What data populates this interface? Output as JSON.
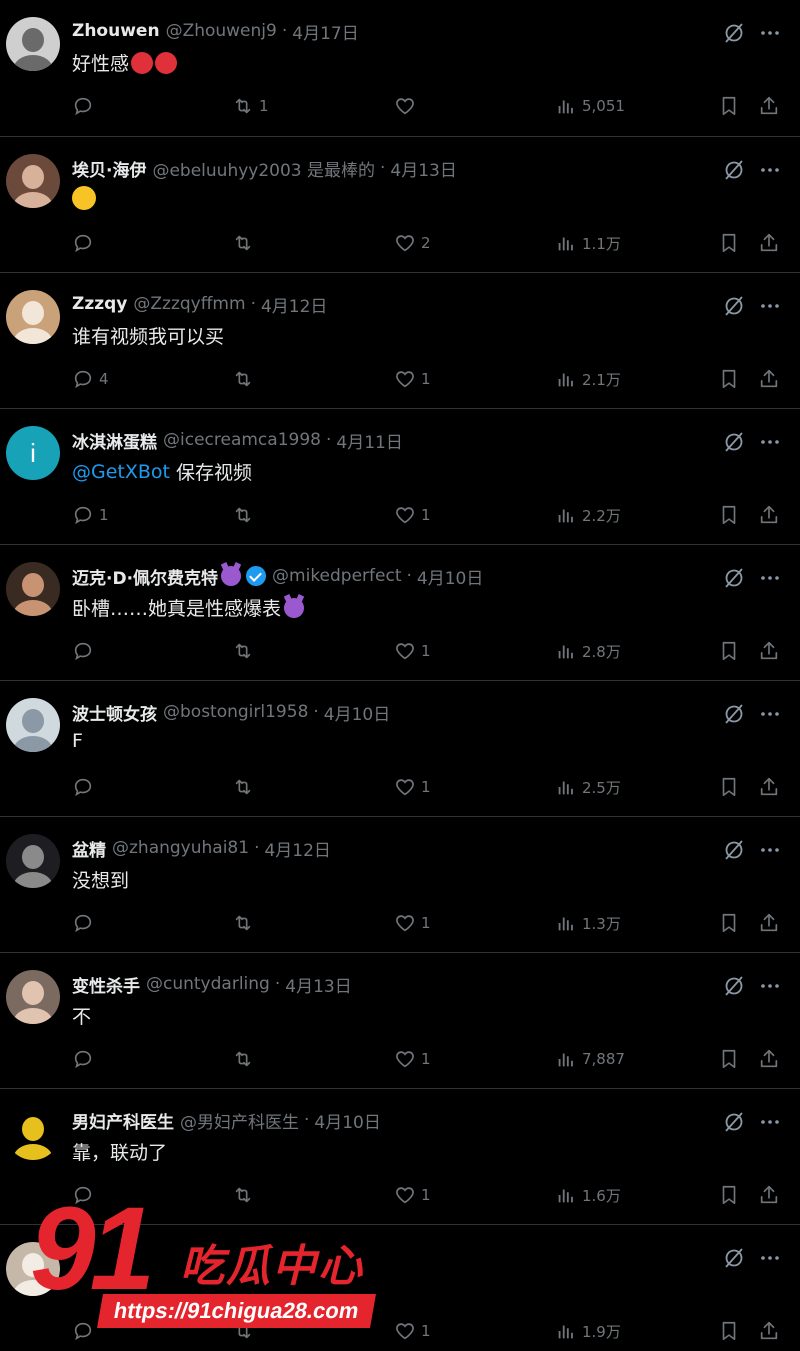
{
  "colors": {
    "background": "#000000",
    "text": "#e7e9ea",
    "muted": "#71767b",
    "link": "#1d9bf0",
    "border": "#2f3336",
    "watermark": "#e5252e"
  },
  "tweets": [
    {
      "name": "Zhouwen",
      "handle": "@Zhouwenj9",
      "date": "4月17日",
      "text": "好性感",
      "name_emoji": "",
      "text_emoji": "hot-face-emoji x2",
      "mention": "",
      "replies": "",
      "retweets": "1",
      "likes": "",
      "views": "5,051",
      "avatar": {
        "bg": "#cfcfcf",
        "fg": "#6a6a6a"
      }
    },
    {
      "name": "埃贝·海伊",
      "handle": "@ebeluuhyy2003 是最棒的",
      "date": "4月13日",
      "text": "",
      "name_emoji": "",
      "text_emoji": "smiling-face-emoji",
      "mention": "",
      "replies": "",
      "retweets": "",
      "likes": "2",
      "views": "1.1万",
      "avatar": {
        "bg": "#6b4a3c",
        "fg": "#d7b19a"
      }
    },
    {
      "name": "Zzzqy",
      "handle": "@Zzzqyffmm",
      "date": "4月12日",
      "text": "谁有视频我可以买",
      "name_emoji": "",
      "text_emoji": "",
      "mention": "",
      "replies": "4",
      "retweets": "",
      "likes": "1",
      "views": "2.1万",
      "avatar": {
        "bg": "#c9a27a",
        "fg": "#f1e6d8"
      }
    },
    {
      "name": "冰淇淋蛋糕",
      "handle": "@icecreamca1998",
      "date": "4月11日",
      "text": "保存视频",
      "name_emoji": "",
      "text_emoji": "",
      "mention": "@GetXBot",
      "replies": "1",
      "retweets": "",
      "likes": "1",
      "views": "2.2万",
      "avatar": {
        "bg": "#17a2b8",
        "fg": "#17a2b8",
        "letter": "i"
      }
    },
    {
      "name": "迈克·D·佩尔费克特",
      "handle": "@mikedperfect",
      "date": "4月10日",
      "text": "卧槽……她真是性感爆表",
      "name_emoji": "smiling-devil-emoji",
      "text_emoji": "smiling-devil-emoji",
      "mention": "",
      "replies": "",
      "retweets": "",
      "likes": "1",
      "views": "2.8万",
      "verified": true,
      "avatar": {
        "bg": "#3a2b22",
        "fg": "#c89372"
      }
    },
    {
      "name": "波士顿女孩",
      "handle": "@bostongirl1958",
      "date": "4月10日",
      "text": "F",
      "name_emoji": "",
      "text_emoji": "",
      "mention": "",
      "replies": "",
      "retweets": "",
      "likes": "1",
      "views": "2.5万",
      "avatar": {
        "bg": "#cfd9de",
        "fg": "#8b98a5"
      }
    },
    {
      "name": "盆精",
      "handle": "@zhangyuhai81",
      "date": "4月12日",
      "text": "没想到",
      "name_emoji": "",
      "text_emoji": "",
      "mention": "",
      "replies": "",
      "retweets": "",
      "likes": "1",
      "views": "1.3万",
      "avatar": {
        "bg": "#1e1e22",
        "fg": "#8a8a8a"
      }
    },
    {
      "name": "变性杀手",
      "handle": "@cuntydarling",
      "date": "4月13日",
      "text": "不",
      "name_emoji": "",
      "text_emoji": "",
      "mention": "",
      "replies": "",
      "retweets": "",
      "likes": "1",
      "views": "7,887",
      "avatar": {
        "bg": "#7a6a60",
        "fg": "#e0c4b0"
      }
    },
    {
      "name": "男妇产科医生",
      "handle": "@男妇产科医生",
      "date": "4月10日",
      "text": "靠，联动了",
      "name_emoji": "",
      "text_emoji": "",
      "mention": "",
      "replies": "",
      "retweets": "",
      "likes": "1",
      "views": "1.6万",
      "avatar": {
        "bg": "#000000",
        "fg": "#e8c01e"
      }
    },
    {
      "name": "",
      "handle": "",
      "date": "",
      "text": "",
      "name_emoji": "",
      "text_emoji": "",
      "mention": "",
      "replies": "",
      "retweets": "",
      "likes": "1",
      "views": "1.9万",
      "avatar": {
        "bg": "#c5b8a8",
        "fg": "#f3ece4"
      }
    }
  ],
  "watermark": {
    "number": "91",
    "title": "吃瓜中心",
    "url": "https://91chigua28.com"
  }
}
